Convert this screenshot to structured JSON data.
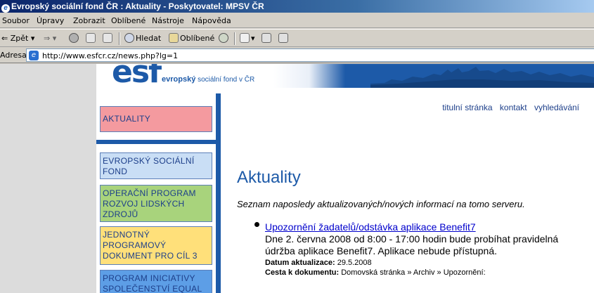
{
  "window": {
    "title": "Evropský sociální fond ČR : Aktuality - Poskytovatel: MPSV ČR"
  },
  "menu": [
    "Soubor",
    "Úpravy",
    "Zobrazit",
    "Oblíbené",
    "Nástroje",
    "Nápověda"
  ],
  "toolbar": {
    "back_label": "Zpět",
    "search_label": "Hledat",
    "favorites_label": "Oblíbené"
  },
  "address": {
    "label": "Adresa",
    "url": "http://www.esfcr.cz/news.php?lg=1"
  },
  "banner": {
    "logo": "esf",
    "subtitle_bold": "evropský",
    "subtitle_rest": "sociální fond v ČR"
  },
  "nav": {
    "aktuality": "AKTUALITY",
    "esf": "EVROPSKÝ SOCIÁLNÍ FOND",
    "op": "OPERAČNÍ PROGRAM ROZVOJ LIDSKÝCH ZDROJŮ",
    "jpd": "JEDNOTNÝ PROGRAMOVÝ DOKUMENT PRO CÍL 3",
    "equal": "PROGRAM INICIATIVY SPOLEČENSTVÍ EQUAL"
  },
  "toplinks": {
    "home": "titulní stránka",
    "contact": "kontakt",
    "search": "vyhledávání"
  },
  "content": {
    "heading": "Aktuality",
    "intro": "Seznam naposledy aktualizovaných/nových informací na tomo serveru.",
    "item": {
      "link": "Upozornění žadatelů/odstávka aplikace Benefit7",
      "text": "Dne 2. června 2008 od 8:00 - 17:00 hodin bude probíhat pravidelná údržba aplikace Benefit7. Aplikace nebude přístupná.",
      "date_label": "Datum aktualizace:",
      "date_value": "29.5.2008",
      "path_label": "Cesta k dokumentu:",
      "path_value": "Domovská stránka » Archiv » Upozornění:"
    }
  },
  "colors": {
    "brand_blue": "#1d5aa8",
    "nav_red": "#f49a9f",
    "nav_lightblue": "#c9def5",
    "nav_green": "#a8d37c",
    "nav_yellow": "#ffe07a",
    "nav_blue": "#5d9ee6"
  }
}
